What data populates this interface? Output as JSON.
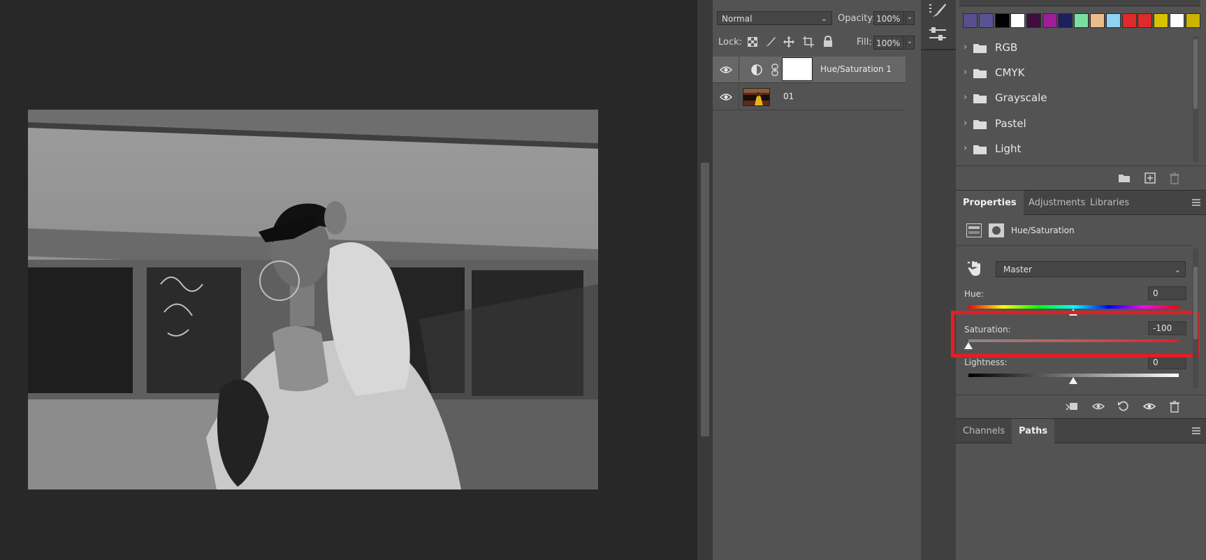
{
  "layers_panel": {
    "blend_mode": "Normal",
    "opacity_label": "Opacity:",
    "opacity_value": "100%",
    "lock_label": "Lock:",
    "fill_label": "Fill:",
    "fill_value": "100%",
    "layers": [
      {
        "name": "Hue/Saturation 1",
        "type": "adjustment",
        "visible": true
      },
      {
        "name": "01",
        "type": "image",
        "visible": true
      }
    ]
  },
  "swatches": {
    "colors": [
      "#574f8f",
      "#5a5294",
      "#000000",
      "#ffffff",
      "#3e0e3f",
      "#9e1e9a",
      "#1e1f5f",
      "#78e0a0",
      "#ebbb8b",
      "#8fd3f2",
      "#e0292b",
      "#dd2a2a",
      "#d8c200",
      "#ffffff",
      "#c9b400"
    ],
    "groups": [
      "RGB",
      "CMYK",
      "Grayscale",
      "Pastel",
      "Light"
    ]
  },
  "properties_panel": {
    "tabs": [
      "Properties",
      "Adjustments",
      "Libraries"
    ],
    "active_tab": "Properties",
    "adjustment_title": "Hue/Saturation",
    "preset": "Master",
    "hue_label": "Hue:",
    "hue_value": "0",
    "saturation_label": "Saturation:",
    "saturation_value": "-100",
    "lightness_label": "Lightness:",
    "lightness_value": "0",
    "highlight_color": "#e51d24"
  },
  "bottom_panel": {
    "tabs": [
      "Channels",
      "Paths"
    ],
    "active_tab": "Paths"
  }
}
